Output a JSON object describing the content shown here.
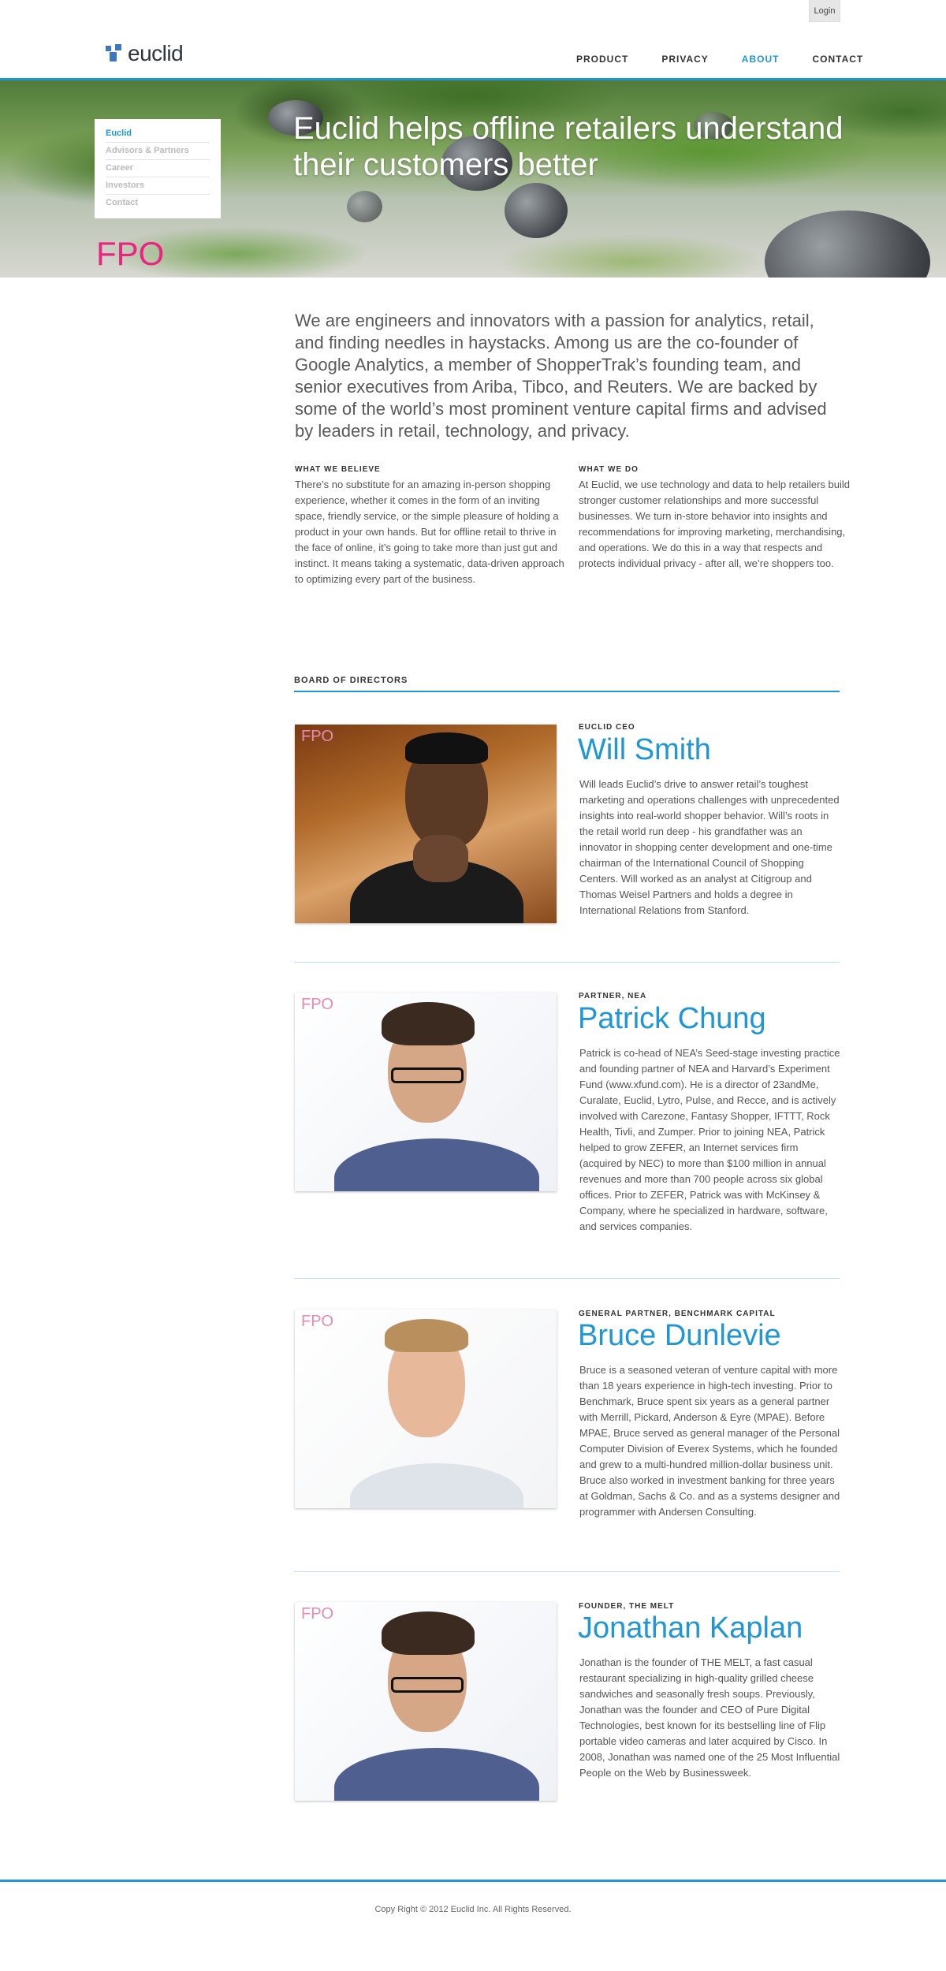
{
  "header": {
    "login_label": "Login",
    "logo_text": "euclid",
    "nav": [
      {
        "label": "PRODUCT",
        "active": false
      },
      {
        "label": "PRIVACY",
        "active": false
      },
      {
        "label": "ABOUT",
        "active": true
      },
      {
        "label": "CONTACT",
        "active": false
      }
    ]
  },
  "hero": {
    "title": "Euclid helps offline retailers understand their customers better",
    "fpo": "FPO",
    "sidenav": [
      "Euclid",
      "Advisors & Partners",
      "Career",
      "Investors",
      "Contact"
    ]
  },
  "intro": {
    "text": "We are engineers and innovators with a passion for analytics, retail, and finding needles in haystacks. Among us are the co-founder of Google Analytics, a member of ShopperTrak’s founding team, and senior executives from Ariba, Tibco, and Reuters. We are backed by some of the world’s most prominent venture capital firms and advised by leaders in retail, technology, and privacy."
  },
  "columns": [
    {
      "heading": "WHAT WE BELIEVE",
      "body": "There’s no substitute for an amazing in-person shopping experience, whether it comes in the form of an inviting space, friendly service, or the simple pleasure of holding a product in your own hands. But for offline retail to thrive in the face of online, it’s going to take more than just gut and instinct. It means taking a systematic, data-driven approach to optimizing every part of the business."
    },
    {
      "heading": "WHAT WE DO",
      "body": "At Euclid, we use technology and data to help retailers build stronger customer relationships and more successful businesses. We turn in-store behavior into insights and recommendations for improving marketing, merchandising, and operations. We do this in a way that respects and protects individual privacy - after all, we’re shoppers too."
    }
  ],
  "board": {
    "heading": "BOARD OF DIRECTORS",
    "fpo": "FPO",
    "members": [
      {
        "role": "EUCLID CEO",
        "name": "Will Smith",
        "bio": "Will leads Euclid’s drive to answer retail’s toughest marketing and operations challenges with unprecedented insights into real-world shopper behavior. Will’s roots in the retail world run deep - his grandfather was an innovator in shopping center development and one-time chairman of the International Council of Shopping Centers. Will worked as an analyst at Citigroup and Thomas Weisel Partners and holds a degree in International Relations from Stanford."
      },
      {
        "role": "PARTNER, NEA",
        "name": "Patrick Chung",
        "bio": "Patrick is co-head of NEA’s Seed-stage investing practice and founding partner of NEA and Harvard’s Experiment Fund (www.xfund.com). He is a director of 23andMe, Curalate, Euclid, Lytro, Pulse, and Recce, and is actively involved with Carezone, Fantasy Shopper, IFTTT, Rock Health, Tivli, and Zumper. Prior to joining NEA, Patrick helped to grow ZEFER, an Internet services firm (acquired by NEC) to more than $100 million in annual revenues and more than 700 people across six global offices. Prior to ZEFER, Patrick was with McKinsey & Company, where he specialized in hardware, software, and services companies."
      },
      {
        "role": "GENERAL PARTNER, BENCHMARK CAPITAL",
        "name": "Bruce Dunlevie",
        "bio": "Bruce is a seasoned veteran of venture capital with more than 18 years experience in high-tech investing. Prior to Benchmark, Bruce spent six years as a general partner with Merrill, Pickard, Anderson & Eyre (MPAE). Before MPAE, Bruce served as general manager of the Personal Computer Division of Everex Systems, which he founded and grew to a multi-hundred million-dollar business unit. Bruce also worked in investment banking for three years at Goldman, Sachs & Co. and as a systems designer and programmer with Andersen Consulting."
      },
      {
        "role": "FOUNDER, THE MELT",
        "name": "Jonathan Kaplan",
        "bio": "Jonathan is the founder of THE MELT, a fast casual restaurant specializing in high-quality grilled cheese sandwiches and seasonally fresh soups. Previously, Jonathan was the founder and CEO of Pure Digital Technologies, best known for its bestselling line of Flip portable video cameras and later acquired by Cisco. In 2008, Jonathan was named one of the 25 Most Influential People on the Web by Businessweek."
      }
    ]
  },
  "footer": {
    "text": "Copy Right © 2012 Euclid Inc. All Rights Reserved."
  },
  "colors": {
    "accent": "#1e96d8",
    "fpo": "#e8267f"
  }
}
